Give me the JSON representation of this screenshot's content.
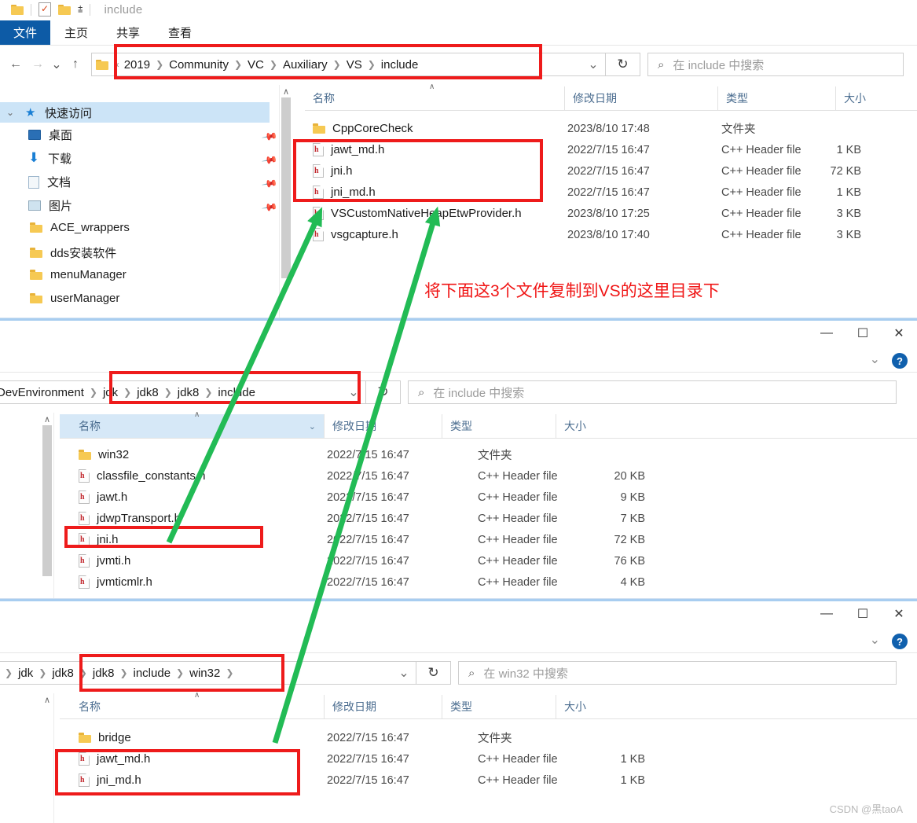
{
  "window1": {
    "title": "include",
    "quick_access_toolbar": [
      "folder-icon",
      "properties-icon",
      "new-folder-icon",
      "customize-dropdown-icon"
    ],
    "ribbon_tabs": [
      {
        "label": "文件",
        "active": true
      },
      {
        "label": "主页",
        "active": false
      },
      {
        "label": "共享",
        "active": false
      },
      {
        "label": "查看",
        "active": false
      }
    ],
    "nav": {
      "back": "←",
      "forward": "→",
      "recent": "⌄",
      "up": "↑",
      "overflow": "«"
    },
    "breadcrumbs": [
      "2019",
      "Community",
      "VC",
      "Auxiliary",
      "VS",
      "include"
    ],
    "refresh_icon": "↻",
    "search": {
      "placeholder": "在 include 中搜索",
      "icon": "search-icon"
    },
    "columns": [
      {
        "label": "名称",
        "sorted": true
      },
      {
        "label": "修改日期"
      },
      {
        "label": "类型"
      },
      {
        "label": "大小"
      }
    ],
    "rows": [
      {
        "name": "CppCoreCheck",
        "icon": "folder",
        "date": "2023/8/10 17:48",
        "type": "文件夹",
        "size": ""
      },
      {
        "name": "jawt_md.h",
        "icon": "header",
        "date": "2022/7/15 16:47",
        "type": "C++ Header file",
        "size": "1 KB"
      },
      {
        "name": "jni.h",
        "icon": "header",
        "date": "2022/7/15 16:47",
        "type": "C++ Header file",
        "size": "72 KB"
      },
      {
        "name": "jni_md.h",
        "icon": "header",
        "date": "2022/7/15 16:47",
        "type": "C++ Header file",
        "size": "1 KB"
      },
      {
        "name": "VSCustomNativeHeapEtwProvider.h",
        "icon": "header",
        "date": "2023/8/10 17:25",
        "type": "C++ Header file",
        "size": "3 KB"
      },
      {
        "name": "vsgcapture.h",
        "icon": "header",
        "date": "2023/8/10 17:40",
        "type": "C++ Header file",
        "size": "3 KB"
      }
    ],
    "sidebar": [
      {
        "label": "快速访问",
        "icon": "star-icon",
        "selected": true,
        "pinned": false,
        "expander": "⌄"
      },
      {
        "label": "桌面",
        "icon": "desktop-icon",
        "pinned": true
      },
      {
        "label": "下载",
        "icon": "download-icon",
        "pinned": true
      },
      {
        "label": "文档",
        "icon": "documents-icon",
        "pinned": true
      },
      {
        "label": "图片",
        "icon": "pictures-icon",
        "pinned": true
      },
      {
        "label": "ACE_wrappers",
        "icon": "folder-icon",
        "pinned": false
      },
      {
        "label": "dds安装软件",
        "icon": "folder-icon",
        "pinned": false
      },
      {
        "label": "menuManager",
        "icon": "folder-icon",
        "pinned": false
      },
      {
        "label": "userManager",
        "icon": "folder-icon",
        "pinned": false
      }
    ]
  },
  "window2": {
    "window_buttons": {
      "minimize": "—",
      "maximize": "☐",
      "close": "✕"
    },
    "ribbon_collapse_icon": "⌄",
    "help_icon": "?",
    "breadcrumbs": [
      "DevEnvironment",
      "jdk",
      "jdk8",
      "jdk8",
      "include"
    ],
    "refresh_icon": "↻",
    "search": {
      "placeholder": "在 include 中搜索",
      "icon": "search-icon"
    },
    "columns": [
      {
        "label": "名称",
        "sorted": true
      },
      {
        "label": "修改日期"
      },
      {
        "label": "类型"
      },
      {
        "label": "大小"
      }
    ],
    "rows": [
      {
        "name": "win32",
        "icon": "folder",
        "date": "2022/7/15 16:47",
        "type": "文件夹",
        "size": ""
      },
      {
        "name": "classfile_constants.h",
        "icon": "header",
        "date": "2022/7/15 16:47",
        "type": "C++ Header file",
        "size": "20 KB"
      },
      {
        "name": "jawt.h",
        "icon": "header",
        "date": "2022/7/15 16:47",
        "type": "C++ Header file",
        "size": "9 KB"
      },
      {
        "name": "jdwpTransport.h",
        "icon": "header",
        "date": "2022/7/15 16:47",
        "type": "C++ Header file",
        "size": "7 KB"
      },
      {
        "name": "jni.h",
        "icon": "header",
        "date": "2022/7/15 16:47",
        "type": "C++ Header file",
        "size": "72 KB"
      },
      {
        "name": "jvmti.h",
        "icon": "header",
        "date": "2022/7/15 16:47",
        "type": "C++ Header file",
        "size": "76 KB"
      },
      {
        "name": "jvmticmlr.h",
        "icon": "header",
        "date": "2022/7/15 16:47",
        "type": "C++ Header file",
        "size": "4 KB"
      }
    ]
  },
  "window3": {
    "window_buttons": {
      "minimize": "—",
      "maximize": "☐",
      "close": "✕"
    },
    "ribbon_collapse_icon": "⌄",
    "help_icon": "?",
    "breadcrumbs": [
      "jdk",
      "jdk8",
      "jdk8",
      "include",
      "win32"
    ],
    "refresh_icon": "↻",
    "search": {
      "placeholder": "在 win32 中搜索",
      "icon": "search-icon"
    },
    "columns": [
      {
        "label": "名称",
        "sorted": true
      },
      {
        "label": "修改日期"
      },
      {
        "label": "类型"
      },
      {
        "label": "大小"
      }
    ],
    "rows": [
      {
        "name": "bridge",
        "icon": "folder",
        "date": "2022/7/15 16:47",
        "type": "文件夹",
        "size": ""
      },
      {
        "name": "jawt_md.h",
        "icon": "header",
        "date": "2022/7/15 16:47",
        "type": "C++ Header file",
        "size": "1 KB"
      },
      {
        "name": "jni_md.h",
        "icon": "header",
        "date": "2022/7/15 16:47",
        "type": "C++ Header file",
        "size": "1 KB"
      }
    ]
  },
  "annotations": {
    "instruction_text": "将下面这3个文件复制到VS的这里目录下",
    "highlight_color": "#ee1b1b",
    "arrow_color": "#22bb55"
  },
  "watermark": "CSDN @黑taoA"
}
